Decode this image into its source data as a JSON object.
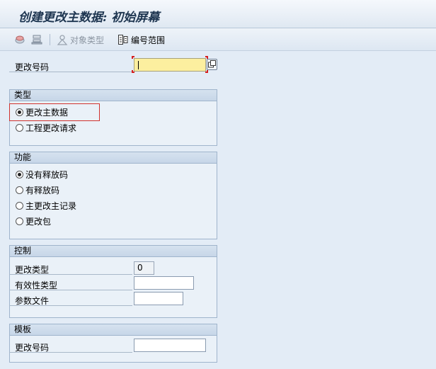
{
  "header": {
    "title": "创建更改主数据: 初始屏幕"
  },
  "toolbar": {
    "object_type_label": "对象类型",
    "number_range_label": "编号范围"
  },
  "main": {
    "change_number_label": "更改号码",
    "change_number_value": ""
  },
  "type_group": {
    "title": "类型",
    "options": [
      {
        "label": "更改主数据",
        "selected": true
      },
      {
        "label": "工程更改请求",
        "selected": false
      }
    ]
  },
  "function_group": {
    "title": "功能",
    "options": [
      {
        "label": "没有释放码",
        "selected": true
      },
      {
        "label": "有释放码",
        "selected": false
      },
      {
        "label": "主更改主记录",
        "selected": false
      },
      {
        "label": "更改包",
        "selected": false
      }
    ]
  },
  "control_group": {
    "title": "控制",
    "change_type_label": "更改类型",
    "change_type_value": "0",
    "validity_type_label": "有效性类型",
    "validity_type_value": "",
    "parameter_file_label": "参数文件",
    "parameter_file_value": ""
  },
  "template_group": {
    "title": "模板",
    "change_number_label": "更改号码",
    "change_number_value": ""
  },
  "colors": {
    "title_text": "#1d3550",
    "required_field": "#fcef9f",
    "highlight_border": "#d0312d",
    "group_header": "#c7d6e8"
  }
}
